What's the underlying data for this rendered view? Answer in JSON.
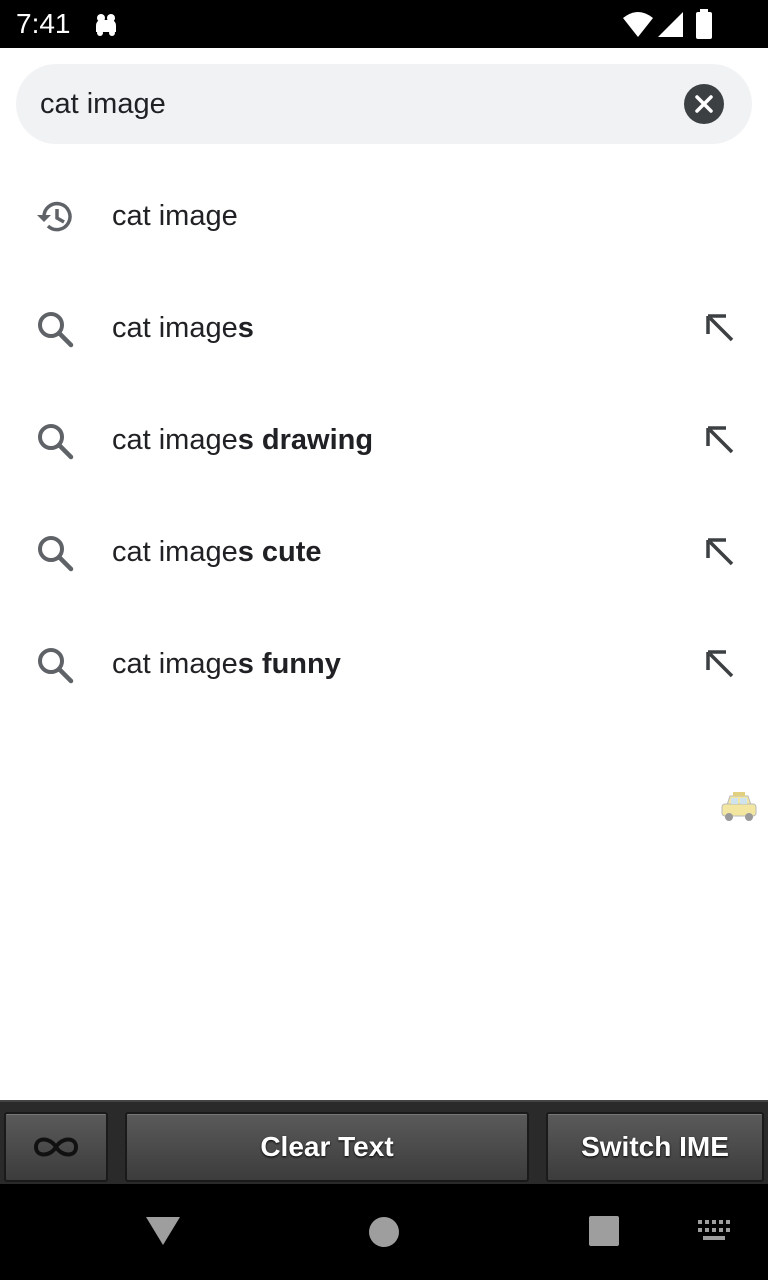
{
  "status_bar": {
    "time": "7:41",
    "icons": [
      "notification-icon",
      "wifi-icon",
      "signal-icon",
      "battery-icon"
    ]
  },
  "search": {
    "value": "cat image",
    "clear_icon": "close-icon"
  },
  "suggestions": [
    {
      "type": "history",
      "icon": "history-icon",
      "prefix": "cat image",
      "bold": ""
    },
    {
      "type": "search",
      "icon": "search-icon",
      "prefix": "cat image",
      "bold": "s"
    },
    {
      "type": "search",
      "icon": "search-icon",
      "prefix": "cat image",
      "bold": "s drawing"
    },
    {
      "type": "search",
      "icon": "search-icon",
      "prefix": "cat image",
      "bold": "s cute"
    },
    {
      "type": "search",
      "icon": "search-icon",
      "prefix": "cat image",
      "bold": "s funny"
    }
  ],
  "helper_bar": {
    "clear_text": "Clear Text",
    "switch_ime": "Switch IME"
  },
  "nav_bar": {
    "icons": [
      "back-icon",
      "home-icon",
      "recents-icon",
      "keyboard-icon"
    ]
  },
  "colors": {
    "search_bg": "#f1f2f4",
    "text": "#202124",
    "icon_gray": "#5f6368"
  }
}
